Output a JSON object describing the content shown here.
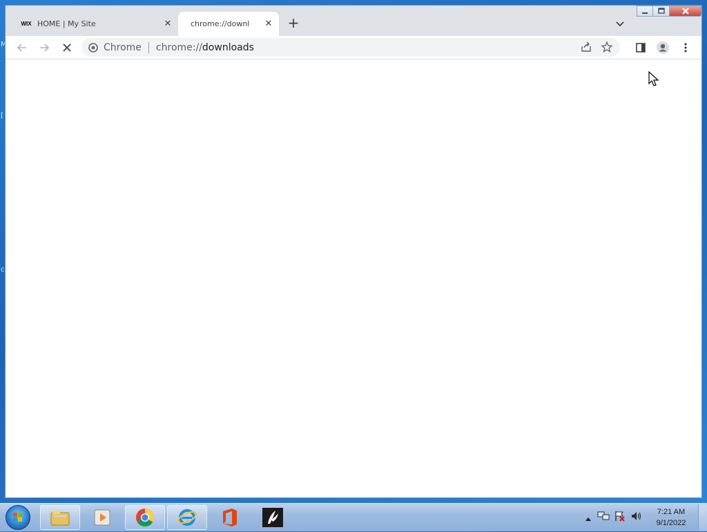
{
  "desktop": {
    "edge_labels": [
      "M",
      "[",
      "c"
    ]
  },
  "browser": {
    "tabs": [
      {
        "favicon": "wix-favicon",
        "favicon_text": "WIX",
        "title": "HOME | My Site",
        "active": false
      },
      {
        "favicon": "loading-favicon",
        "title": "chrome://downl",
        "active": true
      }
    ],
    "new_tab_label": "+",
    "toolbar": {
      "back": "back-arrow-icon",
      "forward": "forward-arrow-icon",
      "stop": "stop-x-icon"
    },
    "omnibox": {
      "chip_label": "Chrome",
      "url_host": "chrome://",
      "url_path": "downloads"
    }
  },
  "taskbar": {
    "items": [
      "windows-explorer",
      "media-player",
      "google-chrome",
      "internet-explorer",
      "microsoft-office",
      "pinned-app"
    ],
    "clock": {
      "time": "7:21 AM",
      "date": "9/1/2022"
    }
  },
  "colors": {
    "tab_strip": "#dee1e6",
    "omnibox": "#f1f3f4",
    "desktop": "#1e63b4"
  }
}
